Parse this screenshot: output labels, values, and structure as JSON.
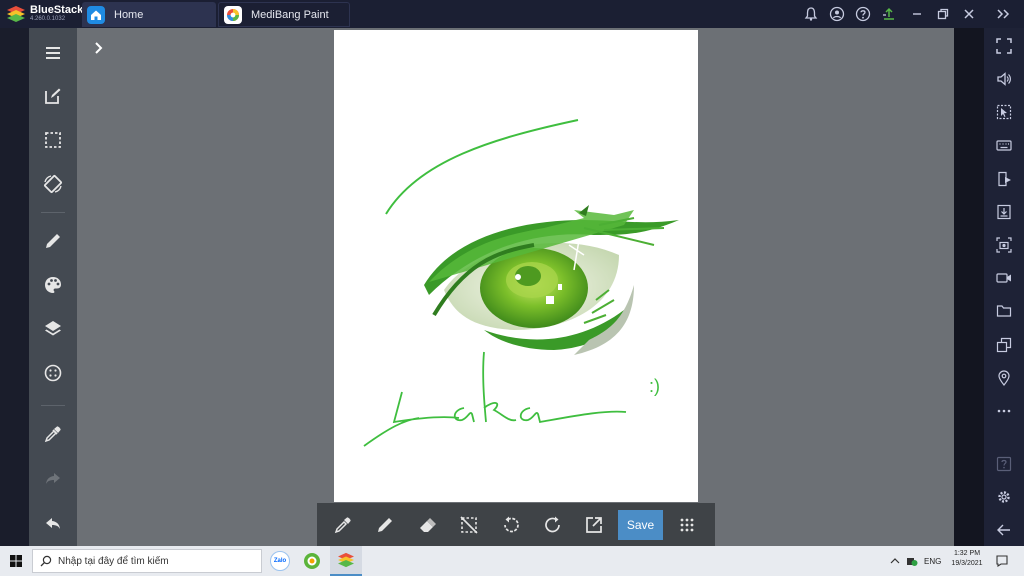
{
  "titlebar": {
    "brand": "BlueStacks",
    "version": "4.260.0.1032",
    "tabs": [
      {
        "label": "Home"
      },
      {
        "label": "MediBang Paint"
      }
    ]
  },
  "canvas": {
    "signature": "Laka",
    "smiley": ":)"
  },
  "bottombar": {
    "save_label": "Save"
  },
  "taskbar": {
    "search_placeholder": "Nhập tại đây để tìm kiếm",
    "zalo_label": "Zalo",
    "lang": "ENG",
    "time": "1:32 PM",
    "date": "19/3/2021"
  },
  "colors": {
    "accent": "#4b8dc6",
    "stroke_green": "#3fbe3f",
    "titlebar": "#1b1f33",
    "toolbar": "#444a52",
    "canvas_bg": "#6c7075"
  }
}
